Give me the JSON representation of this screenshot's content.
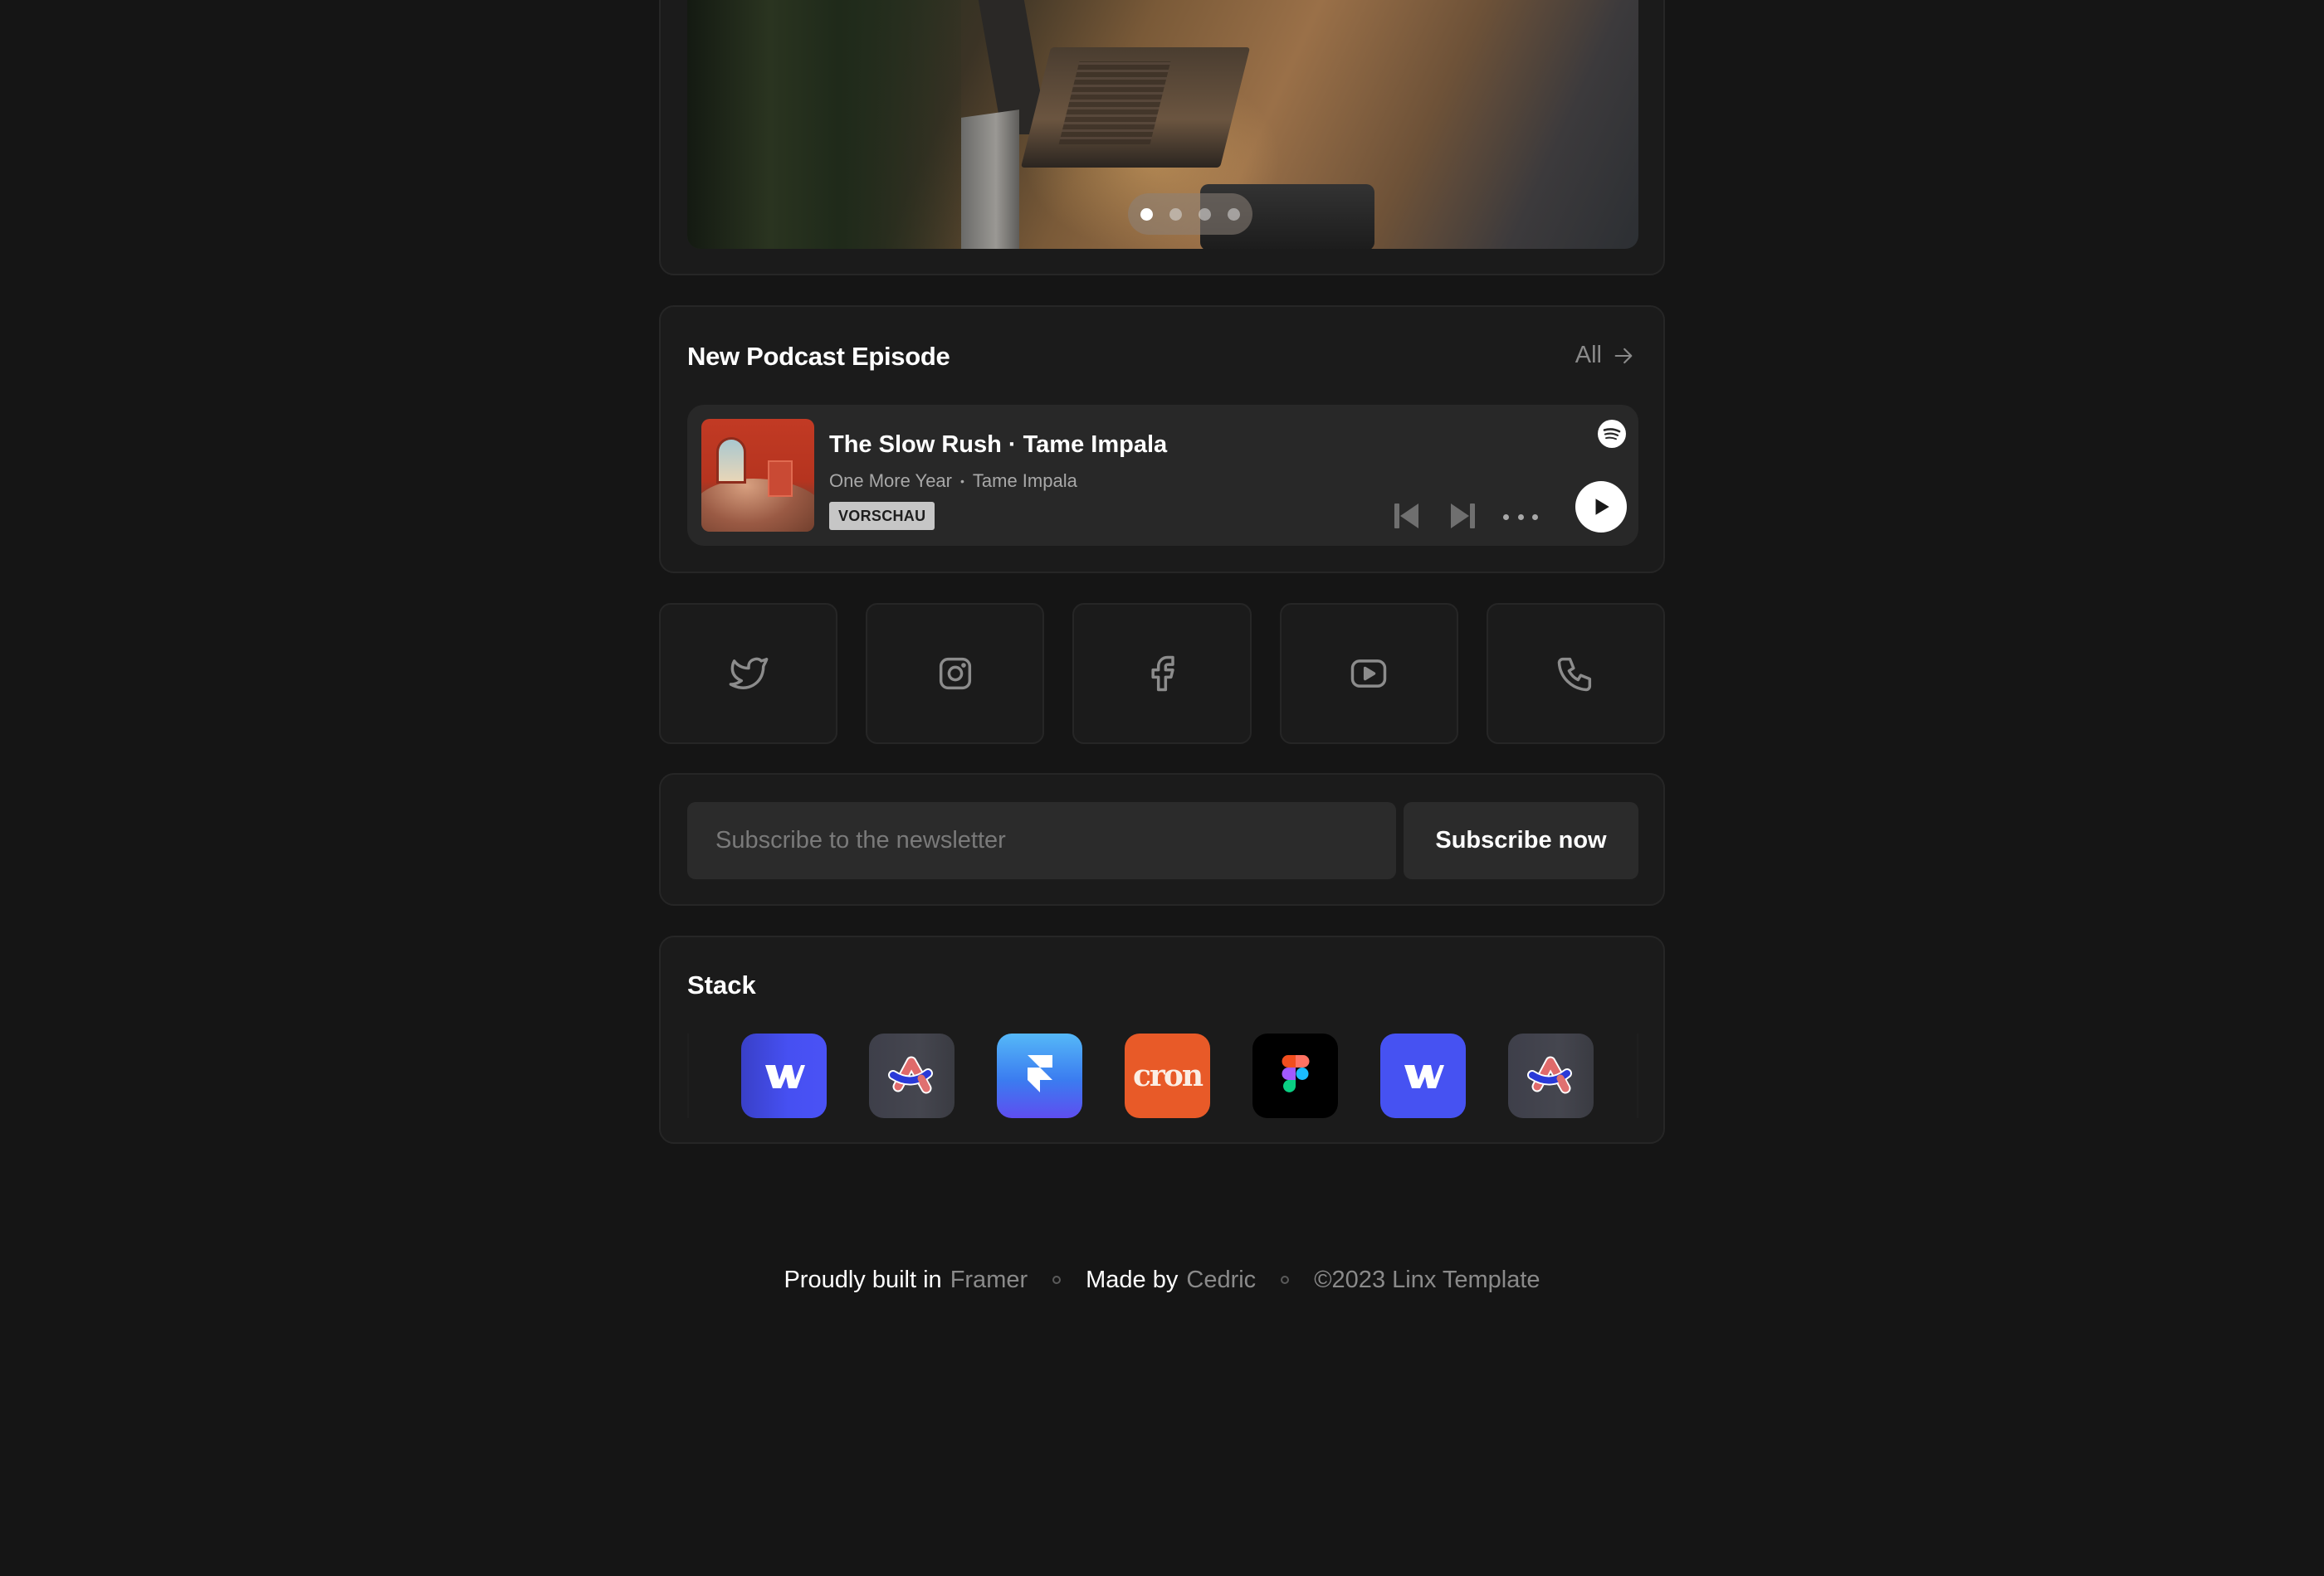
{
  "hero": {
    "image_alt": "Laptop and phone on a wooden desk",
    "carousel": {
      "total_slides": 4,
      "active_index": 0
    }
  },
  "podcast": {
    "title": "New Podcast Episode",
    "all_label": "All",
    "player": {
      "track_title": "The Slow Rush · Tame Impala",
      "song": "One More Year",
      "separator": "•",
      "artist": "Tame Impala",
      "badge": "VORSCHAU",
      "album_art_alt": "The Slow Rush album cover",
      "provider_icon": "spotify-icon",
      "controls": [
        "previous-track",
        "next-track",
        "more-options",
        "play"
      ]
    }
  },
  "social": {
    "links": [
      {
        "name": "twitter",
        "icon": "twitter-icon"
      },
      {
        "name": "instagram",
        "icon": "instagram-icon"
      },
      {
        "name": "facebook",
        "icon": "facebook-icon"
      },
      {
        "name": "youtube",
        "icon": "youtube-icon"
      },
      {
        "name": "phone",
        "icon": "phone-icon"
      }
    ]
  },
  "newsletter": {
    "placeholder": "Subscribe to the newsletter",
    "value": "",
    "button_label": "Subscribe now"
  },
  "stack": {
    "title": "Stack",
    "tools": [
      {
        "name": "Webflow",
        "icon": "webflow-icon",
        "color": "#4652f2"
      },
      {
        "name": "Arc",
        "icon": "arc-icon",
        "color": "#42434c"
      },
      {
        "name": "Framer",
        "icon": "framer-icon",
        "color": "#3b7cf0"
      },
      {
        "name": "Cron",
        "icon": "cron-icon",
        "color": "#e85a28",
        "glyph": "cron"
      },
      {
        "name": "Figma",
        "icon": "figma-icon",
        "color": "#000000"
      },
      {
        "name": "Webflow",
        "icon": "webflow-icon",
        "color": "#4652f2"
      },
      {
        "name": "Arc",
        "icon": "arc-icon",
        "color": "#42434c"
      }
    ]
  },
  "footer": {
    "built_prefix": "Proudly built in",
    "built_link": "Framer",
    "made_prefix": "Made by",
    "made_link": "Cedric",
    "copyright": "©2023 Linx Template"
  },
  "colors": {
    "page_bg": "#151515",
    "card_bg": "#1b1b1b",
    "card_border": "#262626",
    "player_bg": "#282828",
    "muted_text": "#8a8a8a"
  }
}
